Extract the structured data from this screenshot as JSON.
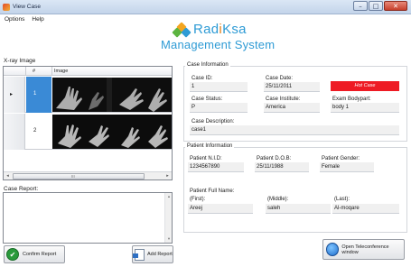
{
  "window": {
    "title": "View Case"
  },
  "menu": [
    "Options",
    "Help"
  ],
  "logo": {
    "line1_a": "Rad",
    "line1_b": "i",
    "line1_c": "Ksa",
    "line2": "Management System"
  },
  "xray": {
    "label": "X-ray Image",
    "col_hash": "#",
    "col_image": "Image",
    "rows": [
      {
        "num": "1",
        "marker": "▸"
      },
      {
        "num": "2",
        "marker": ""
      }
    ],
    "scroll_left": "◂",
    "scroll_right": "▸",
    "scroll_grip": "III"
  },
  "report": {
    "label": "Case Report:",
    "value": "",
    "scroll_up": "▴",
    "scroll_down": "▾"
  },
  "buttons": {
    "confirm": "Confirm Report",
    "add": "Add Report",
    "teleconference": "Open Teleconference window"
  },
  "case_info": {
    "legend": "Case Information",
    "case_id_label": "Case ID:",
    "case_id": "1",
    "case_date_label": "Case Date:",
    "case_date": "25/11/2011",
    "hot_case": "Hot Case",
    "status_label": "Case Status:",
    "status": "P",
    "institute_label": "Case Institute:",
    "institute": "America",
    "bodypart_label": "Exam Bodypart:",
    "bodypart": "body 1",
    "description_label": "Case Description:",
    "description": "case1"
  },
  "patient_info": {
    "legend": "Patient Information",
    "nid_label": "Patient N.I.D:",
    "nid": "1234567890",
    "dob_label": "Patient D.O.B:",
    "dob": "25/11/1988",
    "gender_label": "Patient Gender:",
    "gender": "Female",
    "fullname_label": "Patient Full Name:",
    "first_label": "(First):",
    "first": "Areej",
    "middle_label": "(Middle):",
    "middle": "saleh",
    "last_label": "(Last):",
    "last": "Al-moqare"
  },
  "colors": {
    "brand": "#2e9bd5",
    "hot_case": "#ee1b24",
    "selection": "#3a8ad6",
    "confirm": "#2a9a3c"
  }
}
